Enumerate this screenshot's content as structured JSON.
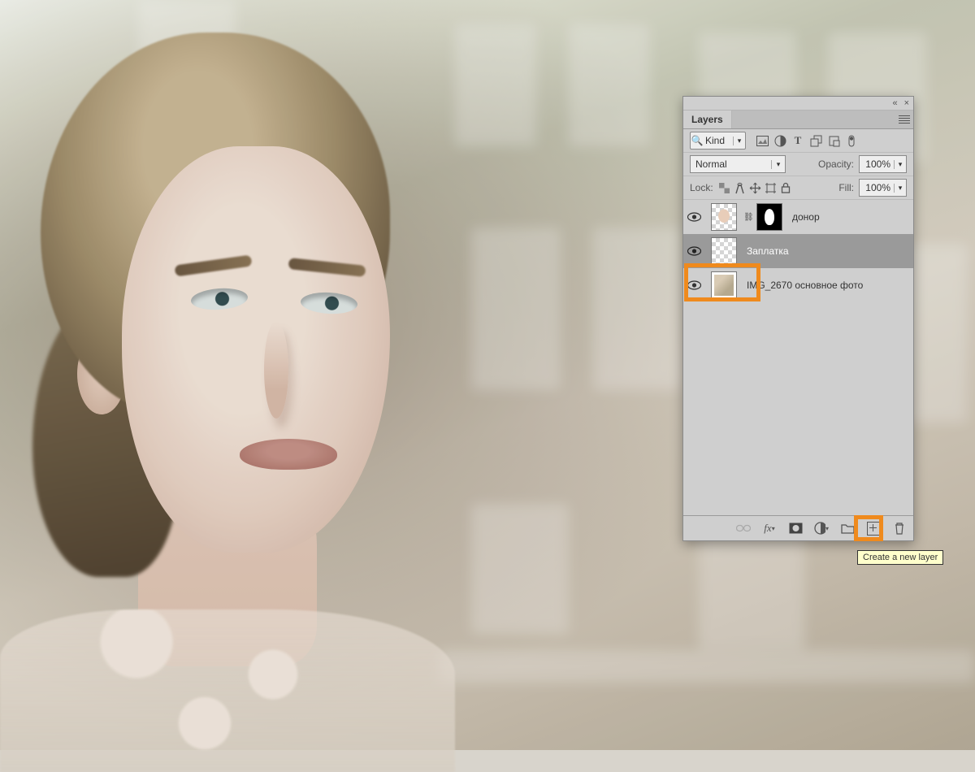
{
  "panel": {
    "title": "Layers",
    "collapse_glyph": "«",
    "close_glyph": "×",
    "filter": {
      "search_glyph": "🔍",
      "kind_label": "Kind",
      "type_icons": [
        "image-icon",
        "adjust-icon",
        "type-icon",
        "shape-icon",
        "smartobj-icon",
        "artboard-icon"
      ]
    },
    "blend_mode": "Normal",
    "opacity_label": "Opacity:",
    "opacity_value": "100%",
    "lock_label": "Lock:",
    "fill_label": "Fill:",
    "fill_value": "100%",
    "layers": [
      {
        "name": "донор",
        "has_mask": true,
        "selected": false
      },
      {
        "name": "Заплатка",
        "has_mask": false,
        "selected": true
      },
      {
        "name": "IMG_2670 основное фото",
        "has_mask": false,
        "selected": false
      }
    ],
    "footer_icons": [
      "link",
      "fx",
      "mask",
      "adjustment",
      "group",
      "new-layer",
      "trash"
    ],
    "tooltip": "Create a new layer"
  },
  "highlight_color": "#ef8a1d"
}
